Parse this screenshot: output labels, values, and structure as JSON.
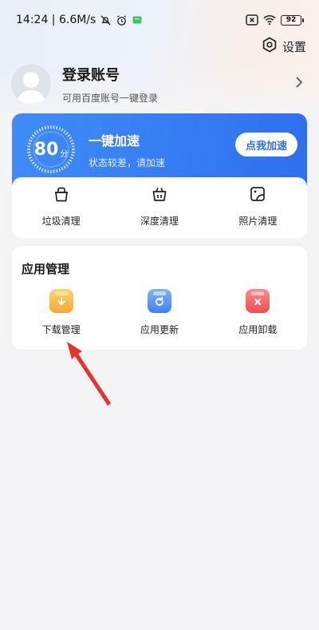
{
  "status_bar": {
    "time_speed": "14:24 | 6.6M/s",
    "battery": "92"
  },
  "settings": {
    "label": "设置"
  },
  "profile": {
    "title": "登录账号",
    "subtitle": "可用百度账号一键登录"
  },
  "speed": {
    "score": "80",
    "unit": "分",
    "title": "一键加速",
    "subtitle": "状态较差，请加速",
    "button": "点我加速"
  },
  "tools": [
    {
      "label": "垃圾清理",
      "icon": "trash-bin-icon"
    },
    {
      "label": "深度清理",
      "icon": "basket-icon"
    },
    {
      "label": "照片清理",
      "icon": "photo-icon"
    }
  ],
  "apps": {
    "title": "应用管理",
    "items": [
      {
        "label": "下载管理",
        "icon": "download-icon",
        "color": "#f7b540"
      },
      {
        "label": "应用更新",
        "icon": "refresh-icon",
        "color": "#4b8ef5"
      },
      {
        "label": "应用卸载",
        "icon": "uninstall-icon",
        "color": "#f25f5f"
      }
    ]
  },
  "colors": {
    "accent": "#2f6fef",
    "annotation_arrow": "#e8312a"
  }
}
